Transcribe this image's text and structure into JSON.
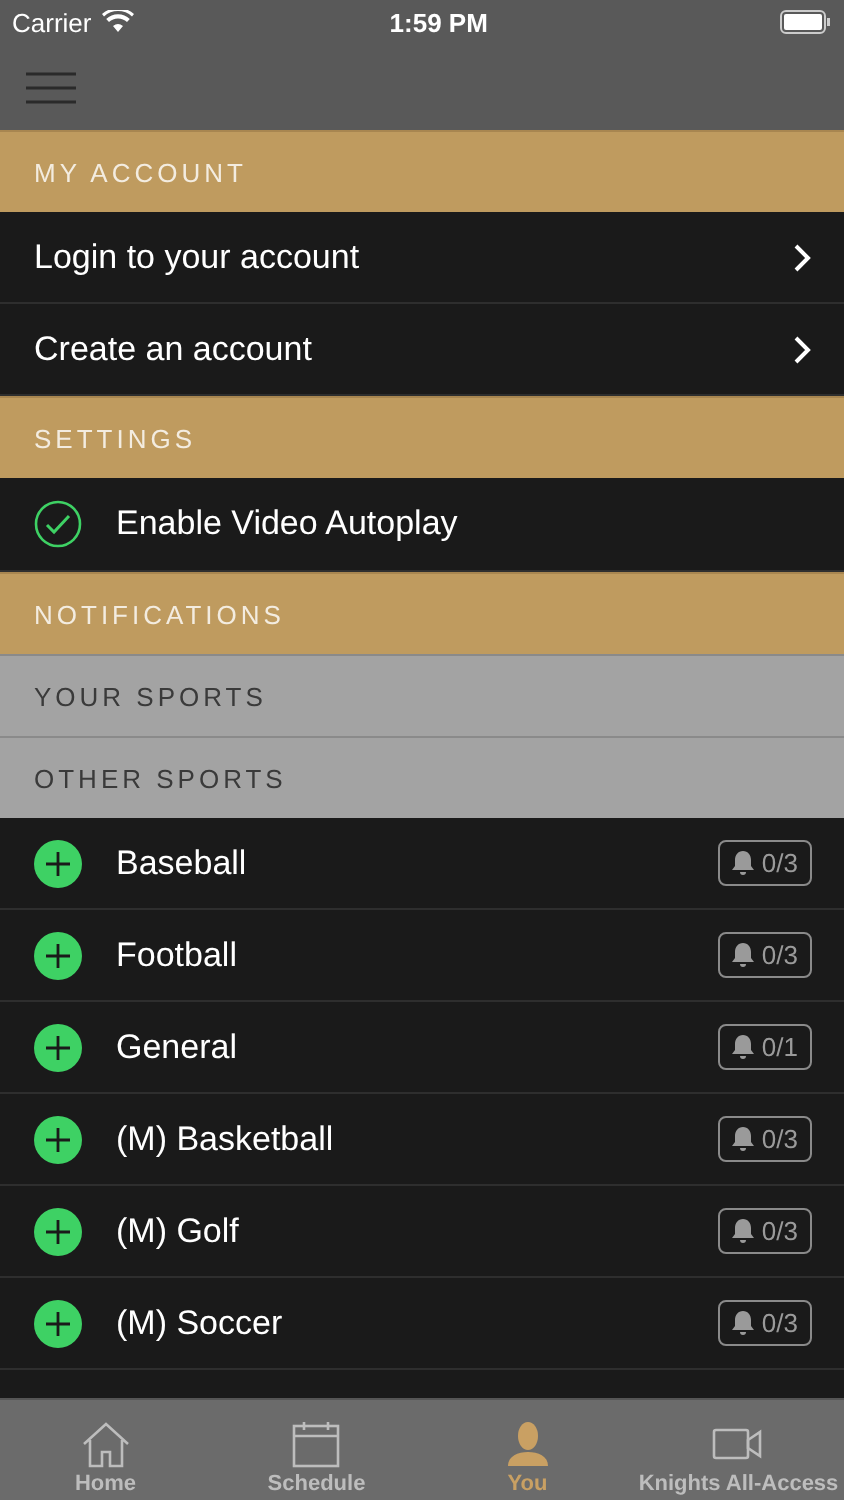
{
  "status_bar": {
    "carrier": "Carrier",
    "time": "1:59 PM"
  },
  "account": {
    "header": "MY ACCOUNT",
    "items": [
      "Login to your account",
      "Create an account"
    ]
  },
  "settings": {
    "header": "SETTINGS",
    "items": [
      {
        "label": "Enable Video Autoplay",
        "checked": true
      }
    ]
  },
  "notifications": {
    "header": "NOTIFICATIONS",
    "your_sports_header": "YOUR SPORTS",
    "other_sports_header": "OTHER SPORTS",
    "other_sports": [
      {
        "name": "Baseball",
        "alerts": "0/3",
        "added": false
      },
      {
        "name": "Football",
        "alerts": "0/3",
        "added": false
      },
      {
        "name": "General",
        "alerts": "0/1",
        "added": false
      },
      {
        "name": "(M) Basketball",
        "alerts": "0/3",
        "added": false
      },
      {
        "name": "(M) Golf",
        "alerts": "0/3",
        "added": false
      },
      {
        "name": "(M) Soccer",
        "alerts": "0/3",
        "added": false
      }
    ]
  },
  "tab_bar": [
    {
      "label": "Home",
      "kind": "home",
      "selected": false
    },
    {
      "label": "Schedule",
      "kind": "calendar",
      "selected": false
    },
    {
      "label": "You",
      "kind": "person",
      "selected": true
    },
    {
      "label": "Knights All-Access",
      "kind": "video",
      "selected": false
    }
  ]
}
